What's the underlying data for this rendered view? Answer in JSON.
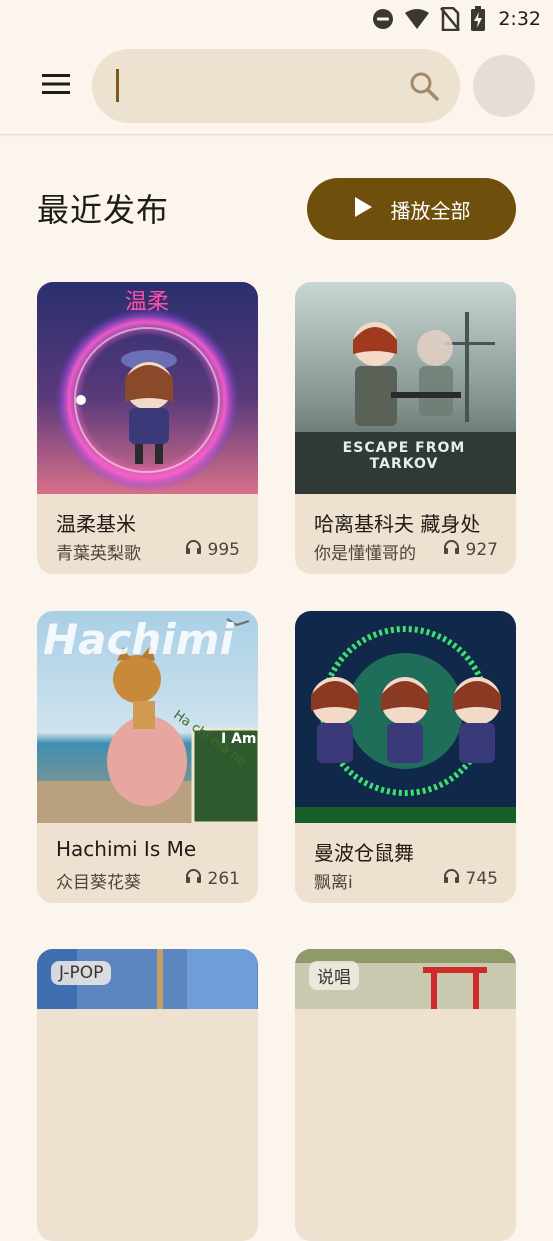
{
  "status_bar": {
    "time": "2:32",
    "icons": [
      "dnd-icon",
      "wifi-icon",
      "no-sim-icon",
      "battery-charging-icon"
    ]
  },
  "top_bar": {
    "menu_icon": "hamburger-menu-icon",
    "search": {
      "value": "",
      "placeholder": "",
      "icon": "search-icon"
    }
  },
  "section": {
    "title": "最近发布",
    "play_all_label": "播放全部",
    "play_all_icon": "play-icon"
  },
  "songs": [
    {
      "title": "温柔基米",
      "artist": "青葉英梨歌",
      "plays": "995",
      "cover_text": "温柔"
    },
    {
      "title": "哈离基科夫 藏身处",
      "artist": "你是懂懂哥的",
      "plays": "927",
      "cover_text": "ESCAPE FROM TARKOV"
    },
    {
      "title": "Hachimi Is Me",
      "artist": "众目葵花葵",
      "plays": "261",
      "cover_text": "Hachimi",
      "cover_text_2": "I Am",
      "cover_text_3": "Ha chi ma ne"
    },
    {
      "title": "曼波仓鼠舞",
      "artist": "飘离i",
      "plays": "745"
    },
    {
      "tag": "J-POP"
    },
    {
      "tag": "说唱"
    }
  ],
  "colors": {
    "background": "#fcf5ee",
    "accent": "#6e4f0c",
    "search_bg": "#ede1cf",
    "card_bg": "#efe1d0"
  }
}
